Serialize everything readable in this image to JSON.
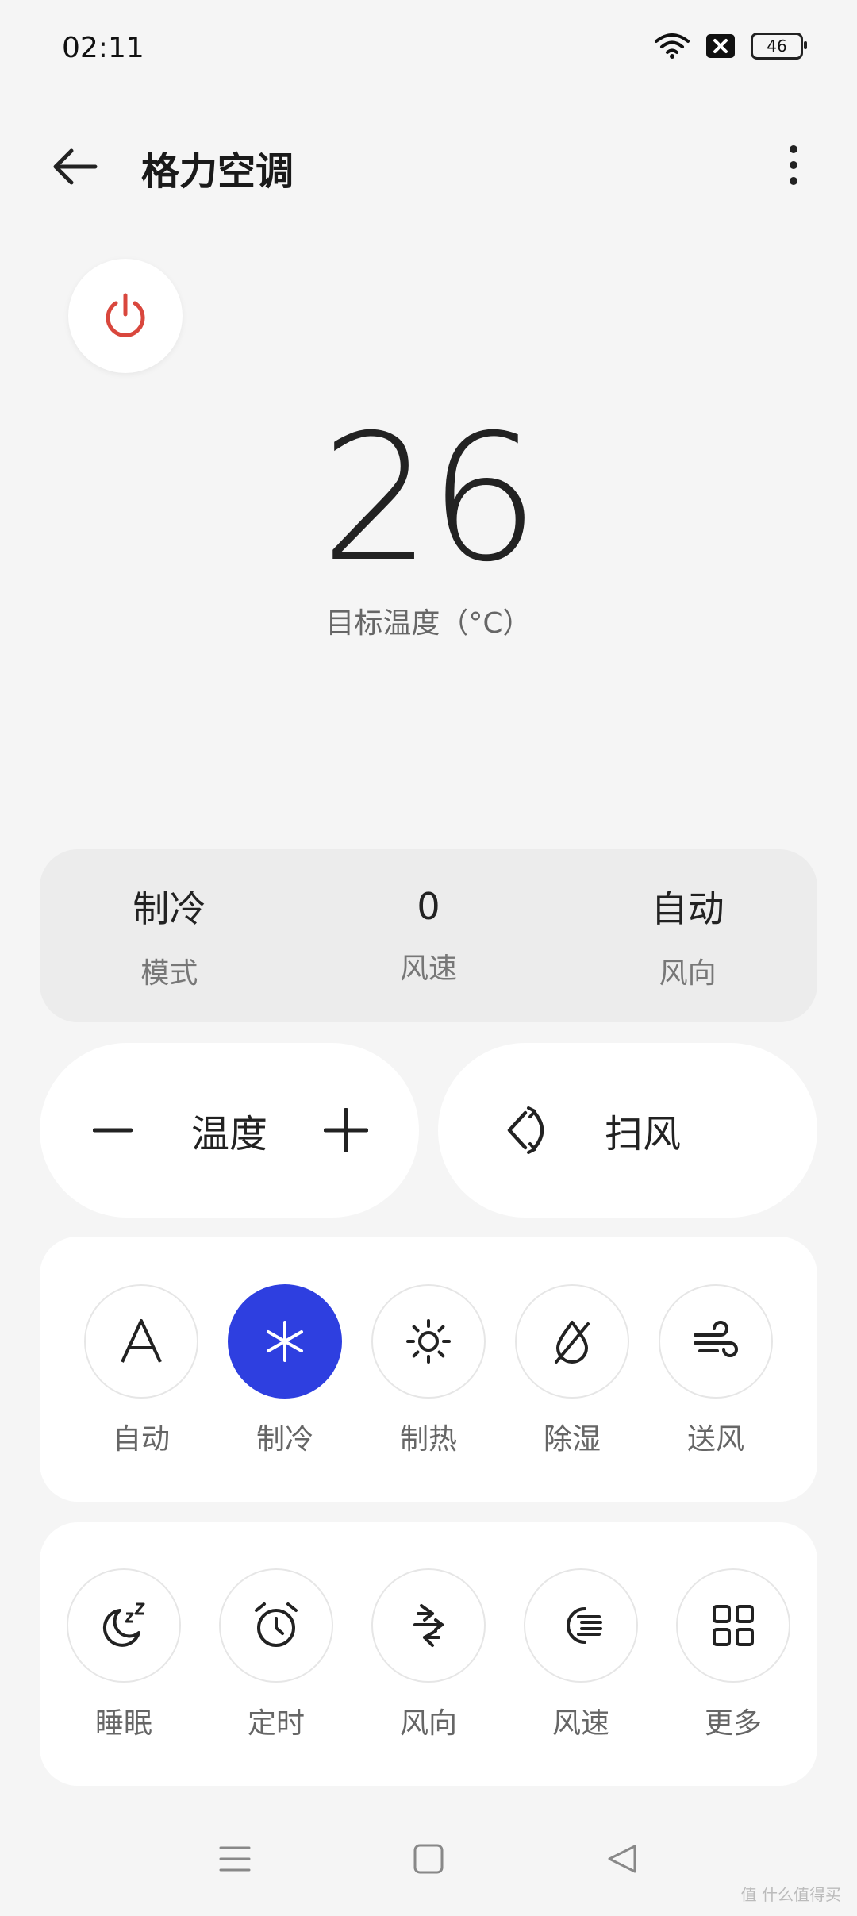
{
  "status": {
    "time": "02:11",
    "battery": "46"
  },
  "header": {
    "title": "格力空调"
  },
  "temperature": {
    "value": "26",
    "label": "目标温度（°C）"
  },
  "summary": [
    {
      "value": "制冷",
      "label": "模式"
    },
    {
      "value": "0",
      "label": "风速"
    },
    {
      "value": "自动",
      "label": "风向"
    }
  ],
  "controls": {
    "temp_label": "温度",
    "swing_label": "扫风"
  },
  "modes": [
    {
      "label": "自动",
      "icon": "auto-icon",
      "active": false
    },
    {
      "label": "制冷",
      "icon": "snowflake-icon",
      "active": true
    },
    {
      "label": "制热",
      "icon": "sun-icon",
      "active": false
    },
    {
      "label": "除湿",
      "icon": "dehumidify-icon",
      "active": false
    },
    {
      "label": "送风",
      "icon": "wind-icon",
      "active": false
    }
  ],
  "functions": [
    {
      "label": "睡眠",
      "icon": "sleep-icon"
    },
    {
      "label": "定时",
      "icon": "alarm-clock-icon"
    },
    {
      "label": "风向",
      "icon": "wind-direction-icon"
    },
    {
      "label": "风速",
      "icon": "fan-speed-icon"
    },
    {
      "label": "更多",
      "icon": "grid-icon"
    }
  ],
  "colors": {
    "accent": "#2e3fe0",
    "power": "#d9473d"
  },
  "watermark": "值 什么值得买"
}
